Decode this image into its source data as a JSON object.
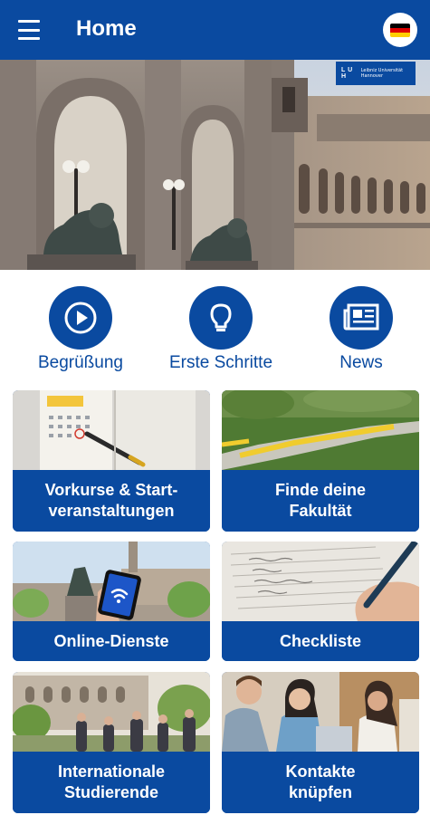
{
  "appbar": {
    "title": "Home",
    "menu_icon": "hamburger-menu-icon",
    "language_icon": "german-flag-icon"
  },
  "hero": {
    "logo_mark": "L U H",
    "logo_text": "Leibniz Universität Hannover"
  },
  "quick_actions": [
    {
      "label": "Begrüßung",
      "icon": "play-icon"
    },
    {
      "label": "Erste Schritte",
      "icon": "lightbulb-icon"
    },
    {
      "label": "News",
      "icon": "newspaper-icon"
    }
  ],
  "tiles": [
    {
      "label_line1": "Vorkurse & Start-",
      "label_line2": "veranstaltungen"
    },
    {
      "label_line1": "Finde deine",
      "label_line2": "Fakultät"
    },
    {
      "label_line1": "Online-Dienste",
      "label_line2": ""
    },
    {
      "label_line1": "Checkliste",
      "label_line2": ""
    },
    {
      "label_line1": "Internationale",
      "label_line2": "Studierende"
    },
    {
      "label_line1": "Kontakte",
      "label_line2": "knüpfen"
    }
  ],
  "colors": {
    "primary": "#0a4aa0",
    "flag_black": "#000000",
    "flag_red": "#dd0000",
    "flag_gold": "#ffce00"
  }
}
